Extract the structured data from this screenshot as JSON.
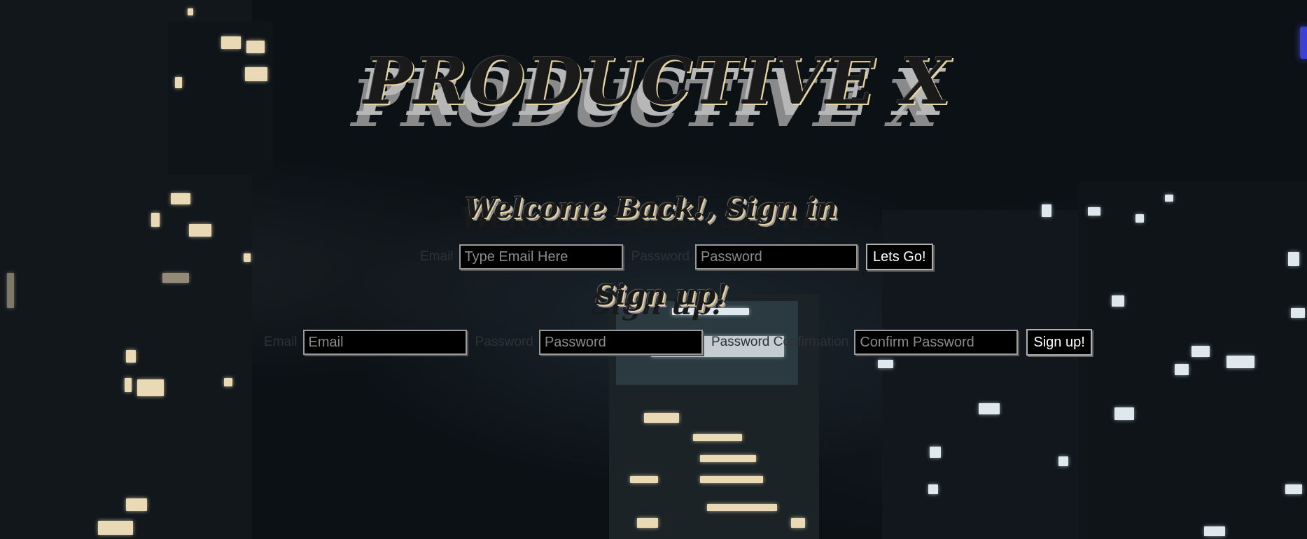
{
  "brand": {
    "title": "PRODUCTIVE X"
  },
  "signin": {
    "title": "Welcome Back!, Sign in",
    "email_label": "Email",
    "email_placeholder": "Type Email Here",
    "password_label": "Password",
    "password_placeholder": "Password",
    "submit_label": "Lets Go!"
  },
  "signup": {
    "title": "Sign up!",
    "email_label": "Email",
    "email_placeholder": "Email",
    "password_label": "Password",
    "password_placeholder": "Password",
    "confirm_label": "Password Confirmation",
    "confirm_placeholder": "Confirm Password",
    "submit_label": "Sign up!"
  },
  "colors": {
    "background": "#0c1116",
    "input_bg": "#000000",
    "heading_highlight": "#e6d3a3"
  }
}
